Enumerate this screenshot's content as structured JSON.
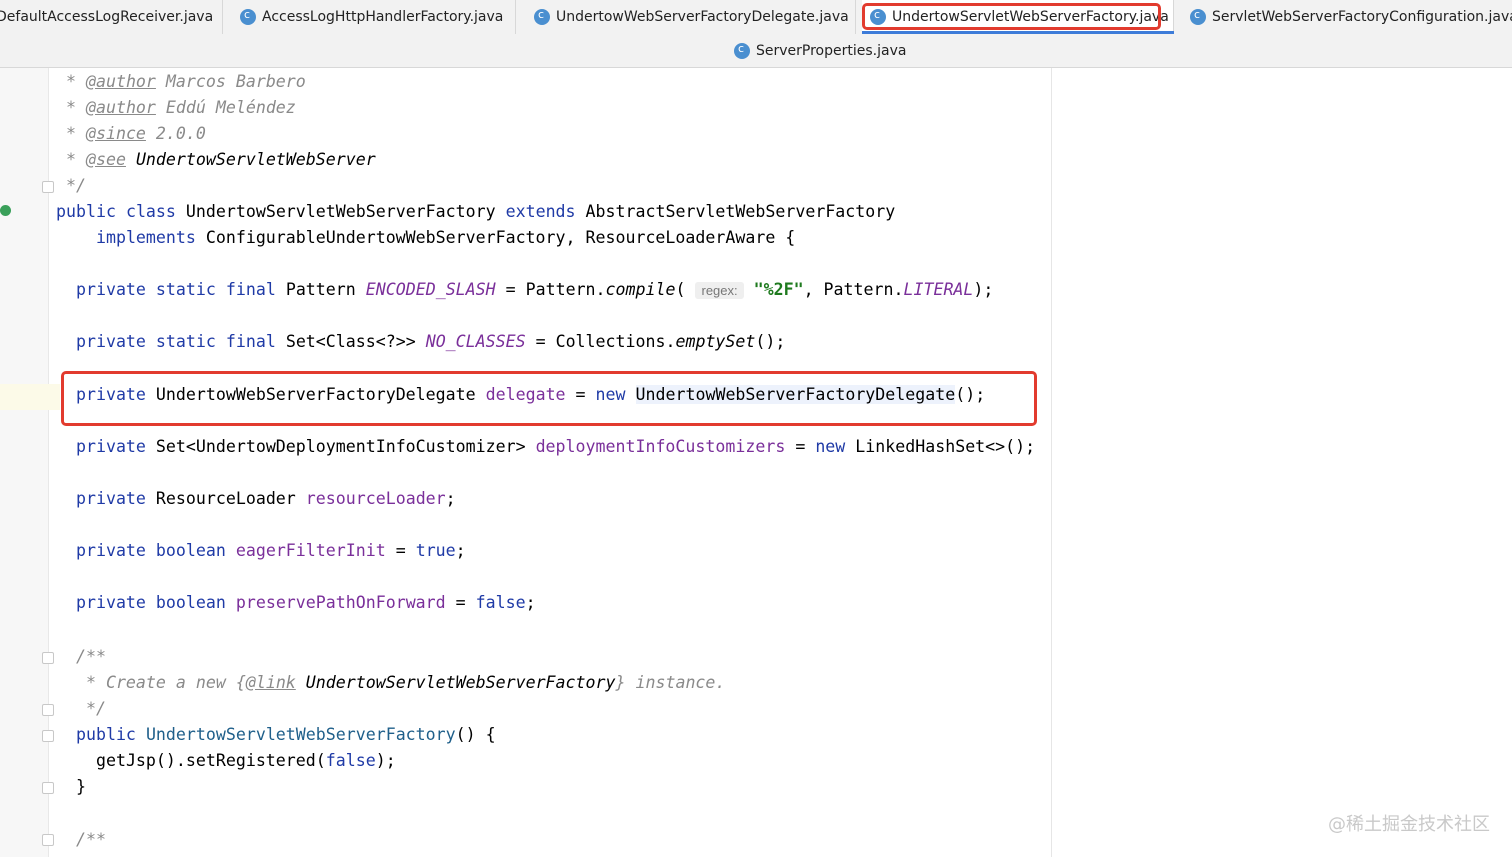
{
  "tabs": [
    {
      "label": "DefaultAccessLogReceiver.java",
      "closable": true
    },
    {
      "label": "AccessLogHttpHandlerFactory.java",
      "closable": true
    },
    {
      "label": "UndertowWebServerFactoryDelegate.java",
      "closable": true
    },
    {
      "label": "UndertowServletWebServerFactory.java",
      "closable": true,
      "active": true
    },
    {
      "label": "ServletWebServerFactoryConfiguration.java",
      "closable": false
    }
  ],
  "tabs_row2": [
    {
      "label": "ServerProperties.java"
    }
  ],
  "code": {
    "l1": {
      "star": " * ",
      "tag": "@author",
      "text": " Marcos Barbero"
    },
    "l2": {
      "star": " * ",
      "tag": "@author",
      "text": " Eddú Meléndez"
    },
    "l3": {
      "star": " * ",
      "tag": "@since",
      "text": " 2.0.0"
    },
    "l4": {
      "star": " * ",
      "tag": "@see",
      "text": " UndertowServletWebServer"
    },
    "l5": {
      "text": " */"
    },
    "l6": {
      "k1": "public",
      "k2": "class",
      "name": "UndertowServletWebServerFactory",
      "k3": "extends",
      "parent": "AbstractServletWebServerFactory"
    },
    "l7": {
      "k1": "implements",
      "rest": " ConfigurableUndertowWebServerFactory, ResourceLoaderAware {"
    },
    "l8": {
      "k1": "private",
      "k2": "static",
      "k3": "final",
      "type": "Pattern",
      "field": "ENCODED_SLASH",
      "mid": " = Pattern.",
      "call": "compile",
      "open": "(",
      "hint": "regex:",
      "str": "\"%2F\"",
      "comma": ", Pattern.",
      "const": "LITERAL",
      "end": ");"
    },
    "l9": {
      "k1": "private",
      "k2": "static",
      "k3": "final",
      "type": "Set<Class<?>>",
      "field": "NO_CLASSES",
      "mid": " = Collections.",
      "call": "emptySet",
      "end": "();"
    },
    "l10": {
      "k1": "private",
      "type": "UndertowWebServerFactoryDelegate",
      "field": "delegate",
      "eq": " = ",
      "k2": "new",
      "ctor": "UndertowWebServerFactoryDelegate",
      "end": "();"
    },
    "l11": {
      "k1": "private",
      "type": "Set<UndertowDeploymentInfoCustomizer>",
      "field": "deploymentInfoCustomizers",
      "eq": " = ",
      "k2": "new",
      "ctor": "LinkedHashSet<>();"
    },
    "l12": {
      "k1": "private",
      "type": "ResourceLoader",
      "field": "resourceLoader",
      "end": ";"
    },
    "l13": {
      "k1": "private",
      "k2": "boolean",
      "field": "eagerFilterInit",
      "eq": " = ",
      "val": "true",
      "end": ";"
    },
    "l14": {
      "k1": "private",
      "k2": "boolean",
      "field": "preservePathOnForward",
      "eq": " = ",
      "val": "false",
      "end": ";"
    },
    "l15": {
      "text": "/**"
    },
    "l16": {
      "pre": " * Create a new ",
      "brace_open": "{",
      "tag": "@link",
      "ref": " UndertowServletWebServerFactory",
      "brace_close": "}",
      "post": " instance."
    },
    "l17": {
      "text": " */"
    },
    "l18": {
      "k1": "public",
      "name": "UndertowServletWebServerFactory",
      "end": "() {"
    },
    "l19": {
      "pre": "getJsp().setRegistered(",
      "val": "false",
      "end": ");"
    },
    "l20": {
      "text": "}"
    },
    "l21": {
      "text": "/**"
    }
  },
  "watermark": "@稀土掘金技术社区",
  "colors": {
    "keyword": "#1f3aa6",
    "field": "#7a2f9a",
    "string": "#1e7a1e",
    "comment": "#8a8a8a",
    "highlight_box": "#e23b2e",
    "active_tab_underline": "#3d7cd9"
  }
}
